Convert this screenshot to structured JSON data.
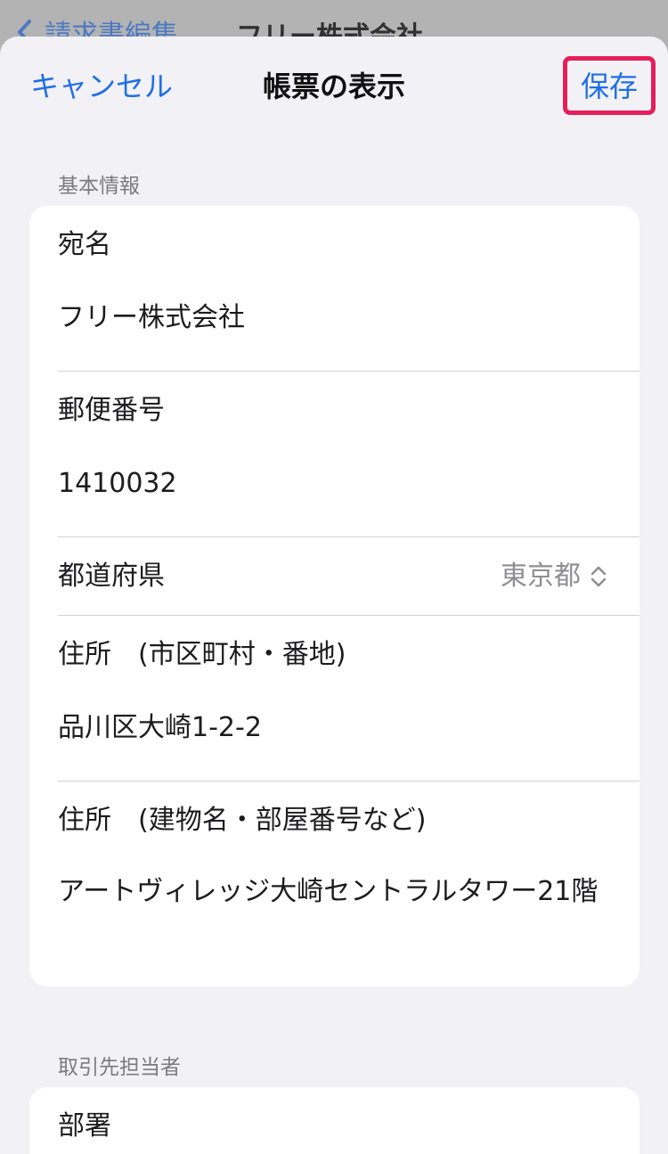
{
  "background_screen": {
    "back_label": "請求書編集",
    "title": "フリー株式会社"
  },
  "nav": {
    "cancel_label": "キャンセル",
    "title": "帳票の表示",
    "save_label": "保存"
  },
  "basic_info": {
    "header": "基本情報",
    "recipient_label": "宛名",
    "recipient_value": "フリー株式会社",
    "postal_label": "郵便番号",
    "postal_value": "1410032",
    "prefecture_label": "都道府県",
    "prefecture_value": "東京都",
    "address1_label": "住所　(市区町村・番地)",
    "address1_value": "品川区大崎1-2-2",
    "address2_label": "住所　(建物名・部屋番号など)",
    "address2_value": "アートヴィレッジ大崎セントラルタワー21階"
  },
  "contact": {
    "header": "取引先担当者",
    "department_label": "部署"
  },
  "colors": {
    "accent": "#1f6fe5",
    "highlight": "#e61e5a"
  }
}
